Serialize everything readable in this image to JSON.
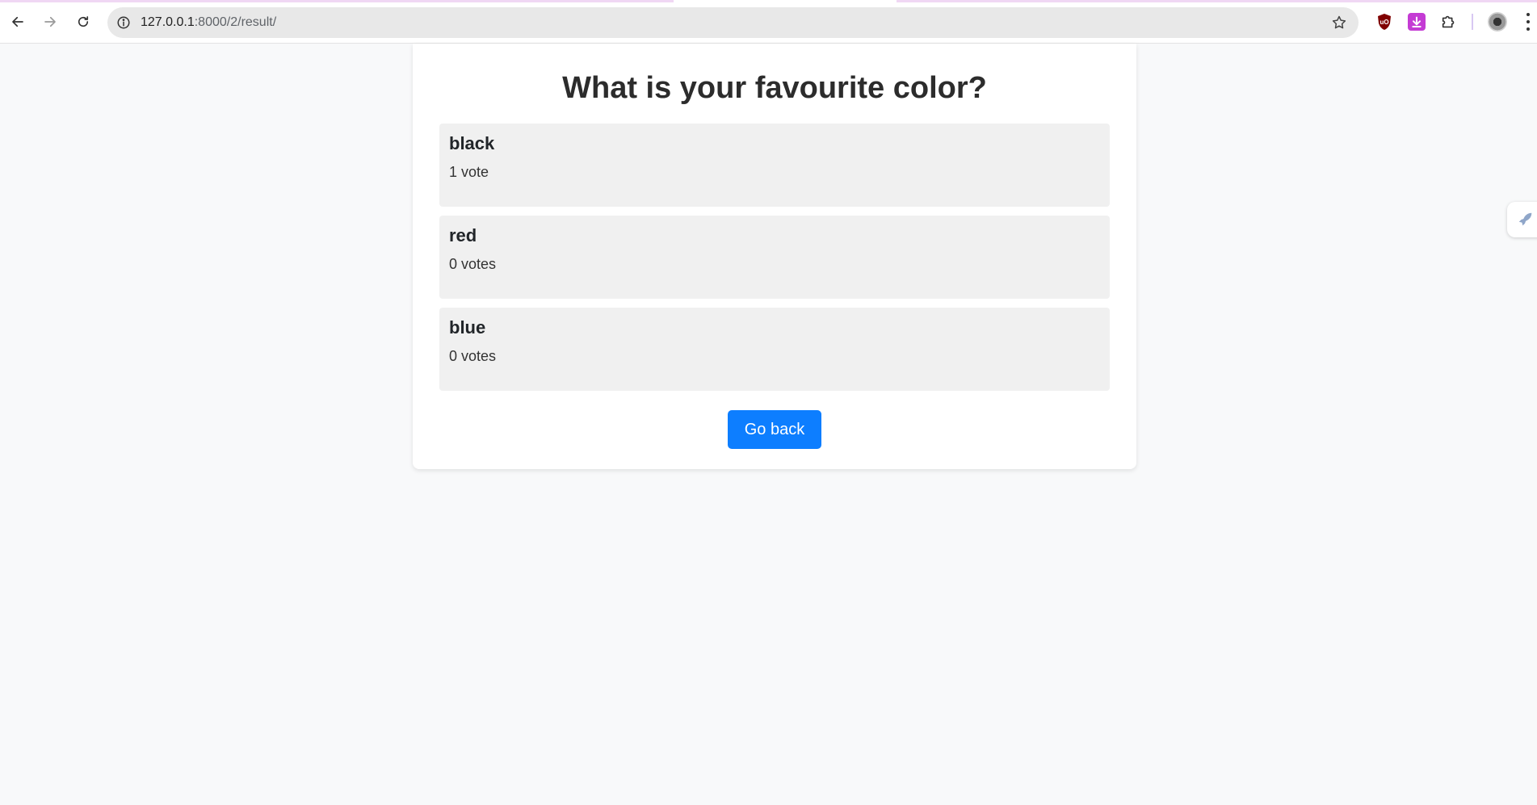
{
  "browser": {
    "url_host": "127.0.0.1",
    "url_rest": ":8000/2/result/",
    "icons": {
      "back": "arrow-left-icon",
      "forward": "arrow-right-icon",
      "reload": "reload-icon",
      "info": "info-icon",
      "bookmark": "star-icon",
      "ublock": "shield-icon",
      "download": "download-icon",
      "extensions": "puzzle-icon",
      "menu": "more-vertical-icon"
    }
  },
  "poll": {
    "question": "What is your favourite color?",
    "choices": [
      {
        "name": "black",
        "votes": "1 vote"
      },
      {
        "name": "red",
        "votes": "0 votes"
      },
      {
        "name": "blue",
        "votes": "0 votes"
      }
    ],
    "back_label": "Go back"
  },
  "colors": {
    "page_bg": "#f8f9fa",
    "card_bg": "#ffffff",
    "choice_bg": "#f0f0f0",
    "primary_button": "#0d7eff",
    "ublock_red": "#800000",
    "download_purple": "#c43bd4"
  }
}
